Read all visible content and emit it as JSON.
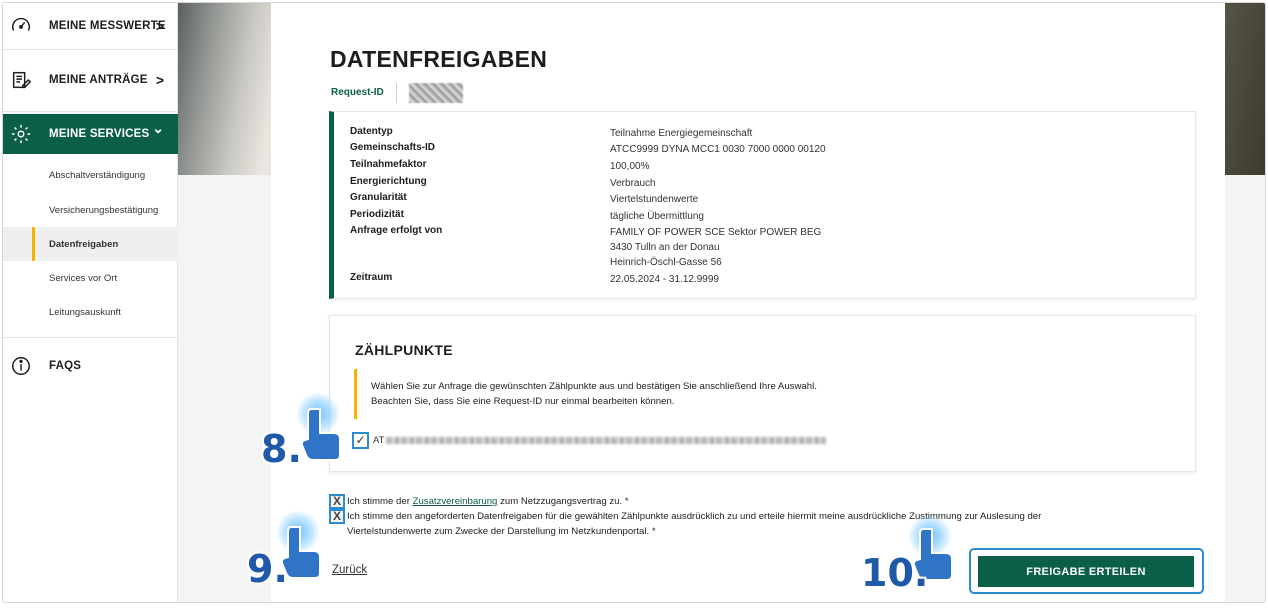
{
  "sidebar": {
    "items": [
      {
        "label": "MEINE MESSWERTE",
        "icon": "gauge-icon",
        "chevron": ">"
      },
      {
        "label": "MEINE ANTRÄGE",
        "icon": "document-edit-icon",
        "chevron": ">"
      },
      {
        "label": "MEINE SERVICES",
        "icon": "gear-icon",
        "chevron": "⌄"
      },
      {
        "label": "FAQS",
        "icon": "info-icon"
      }
    ],
    "sub_items": [
      "Abschaltverständigung",
      "Versicherungsbestätigung",
      "Datenfreigaben",
      "Services vor Ort",
      "Leitungsauskunft"
    ],
    "active_sub": "Datenfreigaben"
  },
  "page": {
    "title": "DATENFREIGABEN",
    "request_id_label": "Request-ID"
  },
  "details": [
    {
      "key": "Datentyp",
      "value": "Teilnahme Energiegemeinschaft"
    },
    {
      "key": "Gemeinschafts-ID",
      "value": "ATCC9999 DYNA MCC1 0030 7000 0000 00120"
    },
    {
      "key": "Teilnahmefaktor",
      "value": "100,00%"
    },
    {
      "key": "Energierichtung",
      "value": "Verbrauch"
    },
    {
      "key": "Granularität",
      "value": "Viertelstundenwerte"
    },
    {
      "key": "Periodizität",
      "value": "tägliche Übermittlung"
    },
    {
      "key": "Anfrage erfolgt von",
      "value": "FAMILY OF POWER SCE Sektor POWER BEG",
      "value2": "3430 Tulln an der Donau",
      "value3": "Heinrich-Öschl-Gasse 56"
    },
    {
      "key": "Zeitraum",
      "value": "22.05.2024 - 31.12.9999"
    }
  ],
  "zaehlpunkte": {
    "title": "ZÄHLPUNKTE",
    "notice_line1": "Wählen Sie zur Anfrage die gewünschten Zählpunkte aus und bestätigen Sie anschließend Ihre Auswahl.",
    "notice_line2": "Beachten Sie, dass Sie eine Request-ID nur einmal bearbeiten können.",
    "item_prefix": "AT",
    "checked_mark": "✓"
  },
  "consent": {
    "c1_pre": "Ich stimme der",
    "c1_link": "Zusatzvereinbarung",
    "c1_post": "zum Netzzugangsvertrag zu. *",
    "c2_line1": "Ich stimme den angeforderten Datenfreigaben für die gewählten Zählpunkte ausdrücklich zu und erteile hiermit meine ausdrückliche Zustimmung zur Auslesung der",
    "c2_line2": "Viertelstundenwerte zum Zwecke der Darstellung im Netzkundenportal. *",
    "box_mark": "X"
  },
  "actions": {
    "back": "Zurück",
    "submit": "FREIGABE ERTEILEN"
  },
  "steps": [
    "8.",
    "9.",
    "10."
  ],
  "colors": {
    "primary": "#0b5e48",
    "accent": "#f0b400",
    "highlight": "#2c8bd1",
    "step": "#1e5aa8"
  }
}
